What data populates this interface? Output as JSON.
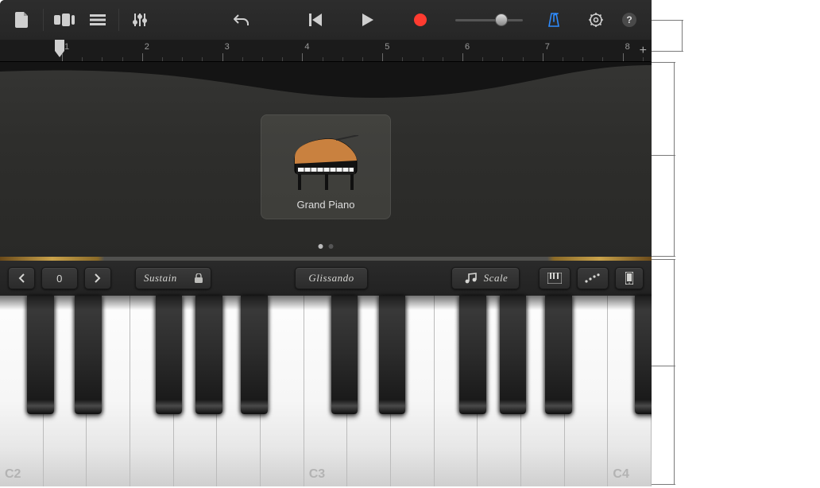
{
  "toolbar": {
    "icons": {
      "my_songs": "my-songs-icon",
      "browser": "instrument-browser-icon",
      "tracks": "tracks-view-icon",
      "mixer": "track-controls-icon",
      "undo": "undo-icon",
      "begin": "go-to-beginning-icon",
      "play": "play-icon",
      "record": "record-icon",
      "metronome": "metronome-icon",
      "settings": "settings-icon",
      "help": "help-icon"
    }
  },
  "ruler": {
    "bars": [
      "1",
      "2",
      "3",
      "4",
      "5",
      "6",
      "7",
      "8"
    ],
    "plus": "+"
  },
  "instrument": {
    "name": "Grand Piano"
  },
  "controls": {
    "octave_value": "0",
    "sustain": "Sustain",
    "glissando": "Glissando",
    "scale": "Scale"
  },
  "keyboard": {
    "labels": [
      "C2",
      "C3",
      "C4"
    ]
  },
  "colors": {
    "record": "#ff3b30",
    "metronome": "#2e8cff"
  }
}
